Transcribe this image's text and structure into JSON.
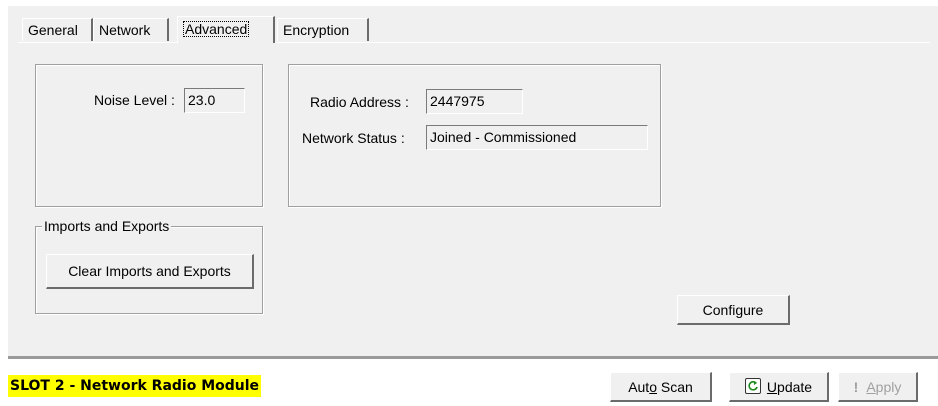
{
  "tabs": [
    {
      "label": "General",
      "active": false
    },
    {
      "label": "Network",
      "active": false
    },
    {
      "label": "Advanced",
      "active": true
    },
    {
      "label": "Encryption",
      "active": false
    }
  ],
  "noise": {
    "label": "Noise Level :",
    "value": "23.0"
  },
  "radio": {
    "address_label": "Radio Address :",
    "address_value": "2447975",
    "status_label": "Network Status :",
    "status_value": "Joined - Commissioned"
  },
  "imports_exports": {
    "legend": "Imports and Exports",
    "clear_button": "Clear Imports and Exports"
  },
  "configure_button": "Configure",
  "footer": {
    "slot_title": "SLOT 2 - Network Radio Module",
    "title_highlight_color": "#ffff00",
    "auto_scan_label": "Auto Scan",
    "update_label": "Update",
    "apply_label": "Apply",
    "apply_enabled": false,
    "update_icon": "refresh-icon",
    "apply_icon": "exclamation-icon"
  }
}
